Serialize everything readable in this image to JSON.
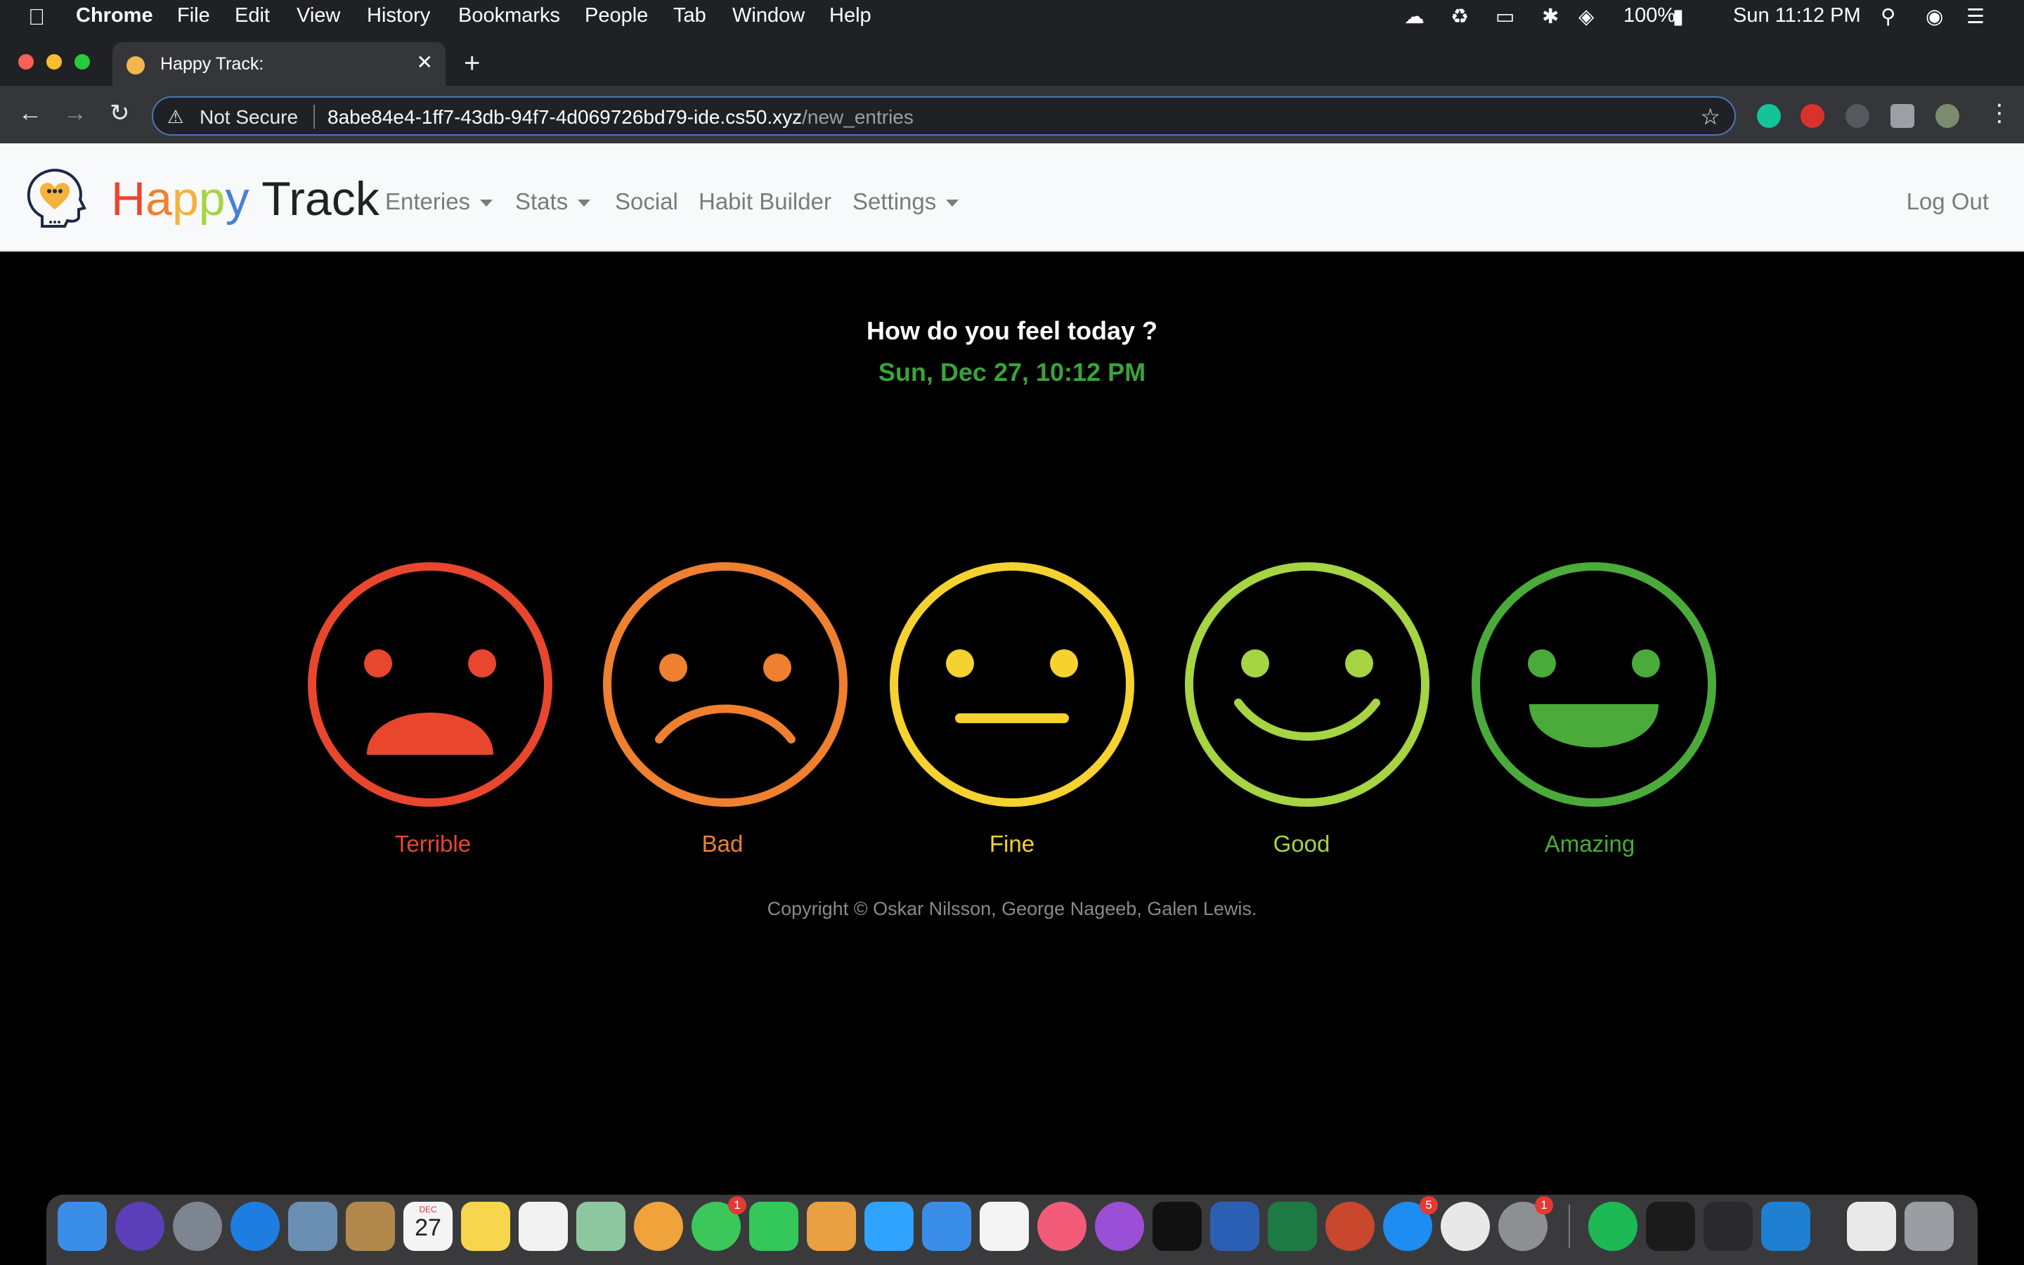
{
  "menubar": {
    "app": "Chrome",
    "items": [
      "File",
      "Edit",
      "View",
      "History",
      "Bookmarks",
      "People",
      "Tab",
      "Window",
      "Help"
    ],
    "battery": "100%",
    "clock": "Sun 11:12 PM"
  },
  "browser": {
    "tab_title": "Happy Track:",
    "security": "Not Secure",
    "url_host": "8abe84e4-1ff7-43db-94f7-4d069726bd79-ide.cs50.xyz",
    "url_path": "/new_entries"
  },
  "navbar": {
    "brand_happy": "Happy",
    "brand_track": "Track",
    "links": [
      {
        "label": "Enteries",
        "dropdown": true
      },
      {
        "label": "Stats",
        "dropdown": true
      },
      {
        "label": "Social",
        "dropdown": false
      },
      {
        "label": "Habit Builder",
        "dropdown": false
      },
      {
        "label": "Settings",
        "dropdown": true
      }
    ],
    "logout": "Log Out"
  },
  "entry": {
    "question": "How do you feel today ?",
    "datetime": "Sun, Dec 27, 10:12 PM",
    "moods": [
      {
        "label": "Terrible",
        "color": "#e8472e",
        "face": "terrible-face-icon"
      },
      {
        "label": "Bad",
        "color": "#ee8030",
        "face": "bad-face-icon"
      },
      {
        "label": "Fine",
        "color": "#f5d22f",
        "face": "fine-face-icon"
      },
      {
        "label": "Good",
        "color": "#a6d442",
        "face": "good-face-icon"
      },
      {
        "label": "Amazing",
        "color": "#4aab3a",
        "face": "amazing-face-icon"
      }
    ],
    "copyright": "Copyright © Oskar Nilsson, George Nageeb, Galen Lewis."
  },
  "dock": {
    "badges": {
      "messages": "1",
      "appstore": "5",
      "settings": "1"
    },
    "calendar_month": "DEC",
    "calendar_day": "27"
  }
}
